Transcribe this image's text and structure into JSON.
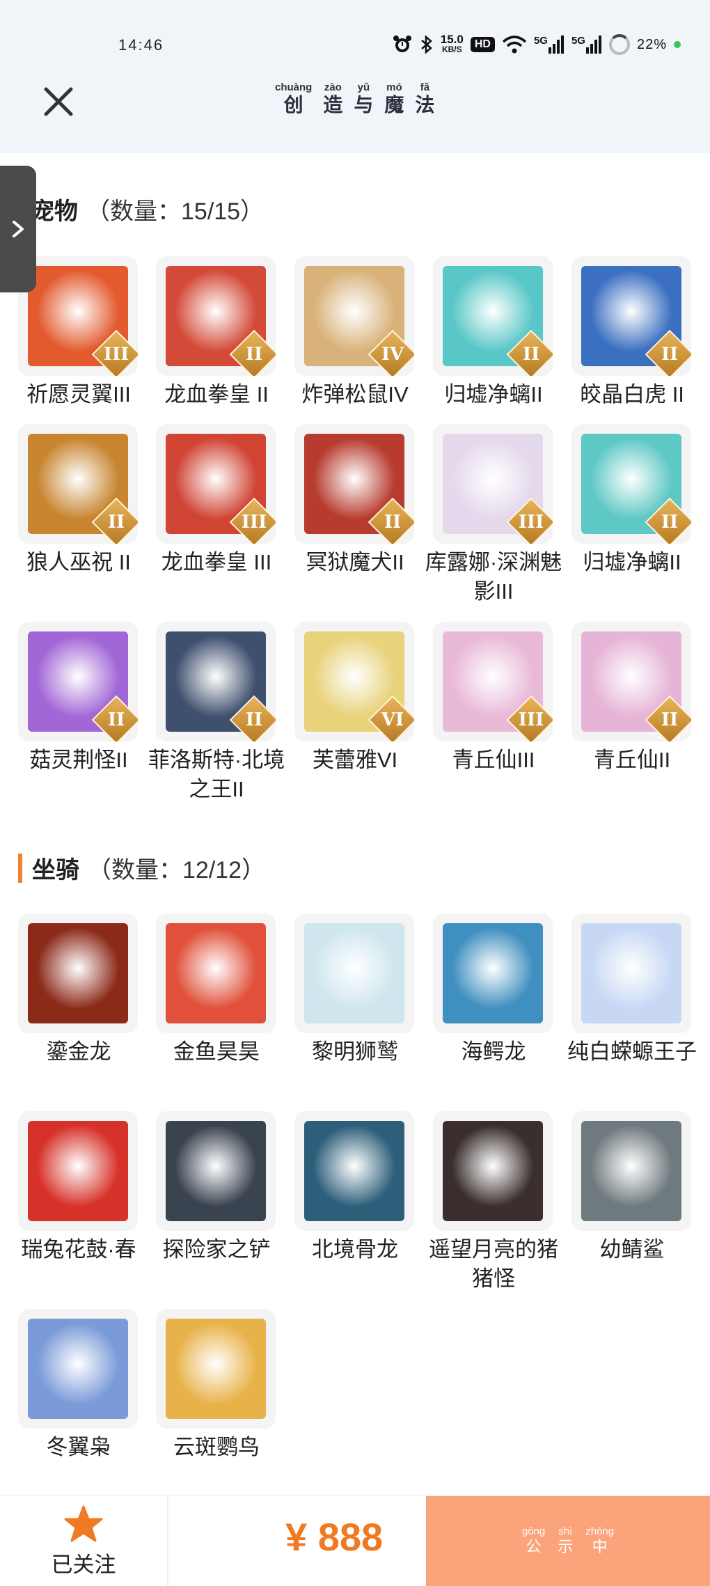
{
  "status": {
    "time": "14:46",
    "speed_value": "15.0",
    "speed_unit": "KB/S",
    "hd": "HD",
    "net1": "5G",
    "net2": "5G",
    "battery": "22%"
  },
  "header": {
    "title": [
      {
        "py": "chuàng",
        "hz": "创"
      },
      {
        "py": "zào",
        "hz": "造"
      },
      {
        "py": "yǔ",
        "hz": "与"
      },
      {
        "py": "mó",
        "hz": "魔"
      },
      {
        "py": "fǎ",
        "hz": "法"
      }
    ]
  },
  "pets": {
    "name": "宠物",
    "count": "（数量：15/15）",
    "items": [
      {
        "label": "祈愿灵翼III",
        "tier": "III",
        "color": "#e35a2e"
      },
      {
        "label": "龙血拳皇 II",
        "tier": "II",
        "color": "#d44a38"
      },
      {
        "label": "炸弹松鼠IV",
        "tier": "IV",
        "color": "#d8b27a"
      },
      {
        "label": "归墟净螭II",
        "tier": "II",
        "color": "#59c7c7"
      },
      {
        "label": "皎晶白虎 II",
        "tier": "II",
        "color": "#3b6fc0"
      },
      {
        "label": "狼人巫祝 II",
        "tier": "II",
        "color": "#c7852f"
      },
      {
        "label": "龙血拳皇 III",
        "tier": "III",
        "color": "#d04434"
      },
      {
        "label": "冥狱魔犬II",
        "tier": "II",
        "color": "#b73b2e"
      },
      {
        "label": "库露娜·深渊魅影III",
        "tier": "III",
        "color": "#e4d8ec"
      },
      {
        "label": "归墟净螭II",
        "tier": "II",
        "color": "#5ec8c4"
      },
      {
        "label": "菇灵荆怪II",
        "tier": "II",
        "color": "#a267d6"
      },
      {
        "label": "菲洛斯特·北境之王II",
        "tier": "II",
        "color": "#3f4f6e"
      },
      {
        "label": "芙蕾雅VI",
        "tier": "VI",
        "color": "#e8d27a"
      },
      {
        "label": "青丘仙III",
        "tier": "III",
        "color": "#e9b9d8"
      },
      {
        "label": "青丘仙II",
        "tier": "II",
        "color": "#e6b4d6"
      }
    ]
  },
  "mounts": {
    "name": "坐骑",
    "count": "（数量：12/12）",
    "items": [
      {
        "label": "鎏金龙",
        "color": "#8c2a1a"
      },
      {
        "label": "金鱼昊昊",
        "color": "#e0503a"
      },
      {
        "label": "黎明狮鹫",
        "color": "#cfe6ee"
      },
      {
        "label": "海鳄龙",
        "color": "#3f8fc0"
      },
      {
        "label": "纯白蝾螈王子",
        "color": "#c8d8f4"
      },
      {
        "label": "瑞兔花鼓·春",
        "color": "#d7322a"
      },
      {
        "label": "探险家之铲",
        "color": "#3a4350"
      },
      {
        "label": "北境骨龙",
        "color": "#2e5f7a"
      },
      {
        "label": "遥望月亮的猪猪怪",
        "color": "#3a2e2e"
      },
      {
        "label": "幼鲭鲨",
        "color": "#6f7a7e"
      },
      {
        "label": "冬翼枭",
        "color": "#7a9ad8"
      },
      {
        "label": "云斑鹦鸟",
        "color": "#e8b24a"
      }
    ]
  },
  "bottom": {
    "follow_label": "已关注",
    "price": "¥ 888",
    "publicity": [
      {
        "py": "gōng",
        "hz": "公"
      },
      {
        "py": "shì",
        "hz": "示"
      },
      {
        "py": "zhōng",
        "hz": "中"
      }
    ]
  },
  "colors": {
    "accent": "#f0822e",
    "price": "#f07a22",
    "publicity_bg": "#fba37a",
    "star": "#f07a22"
  }
}
